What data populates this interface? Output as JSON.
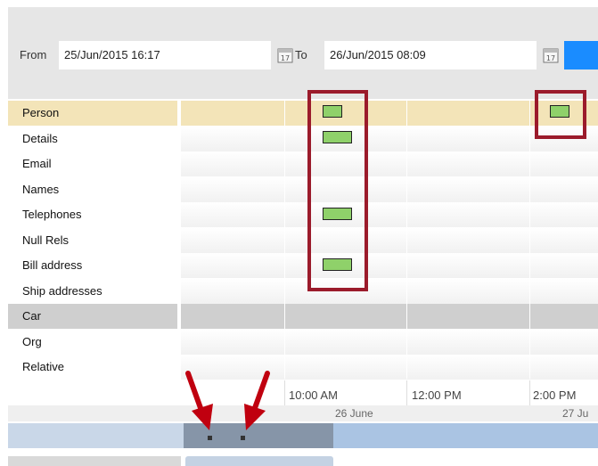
{
  "filter": {
    "from_label": "From",
    "from_value": "25/Jun/2015 16:17",
    "to_label": "To",
    "to_value": "26/Jun/2015 08:09",
    "calendar_icon": "calendar-icon"
  },
  "rows": [
    {
      "label": "Person",
      "style": "highlight"
    },
    {
      "label": "Details",
      "style": "plain"
    },
    {
      "label": "Email",
      "style": "plain"
    },
    {
      "label": "Names",
      "style": "plain"
    },
    {
      "label": "Telephones",
      "style": "plain"
    },
    {
      "label": "Null Rels",
      "style": "plain"
    },
    {
      "label": "Bill address",
      "style": "plain"
    },
    {
      "label": "Ship addresses",
      "style": "plain"
    },
    {
      "label": "Car",
      "style": "group"
    },
    {
      "label": "Org",
      "style": "plain"
    },
    {
      "label": "Relative",
      "style": "plain"
    }
  ],
  "axis": {
    "times": [
      "10:00 AM",
      "12:00 PM",
      "2:00 PM"
    ],
    "dates": [
      "26 June",
      "27 Ju"
    ]
  },
  "colors": {
    "accent": "#1a8cff",
    "highlight_row": "#f3e4b8",
    "event_marker": "#8fd16a",
    "callout_box": "#9b1b2b",
    "arrow": "#c0000f"
  }
}
